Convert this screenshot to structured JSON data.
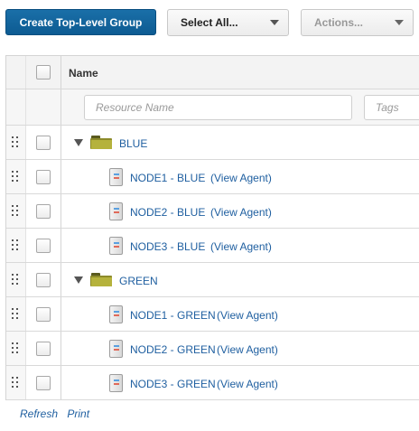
{
  "toolbar": {
    "create_button": "Create Top-Level Group",
    "select_all": "Select All...",
    "actions": "Actions..."
  },
  "table": {
    "header": {
      "name": "Name"
    },
    "filters": {
      "name_placeholder": "Resource Name",
      "tags_placeholder": "Tags"
    },
    "groups": [
      {
        "label": "BLUE",
        "nodes": [
          {
            "label": "NODE1 - BLUE",
            "link": "(View Agent)"
          },
          {
            "label": "NODE2 - BLUE",
            "link": "(View Agent)"
          },
          {
            "label": "NODE3 - BLUE",
            "link": "(View Agent)"
          }
        ]
      },
      {
        "label": "GREEN",
        "nodes": [
          {
            "label": "NODE1 - GREEN",
            "link": "(View Agent)"
          },
          {
            "label": "NODE2 - GREEN",
            "link": "(View Agent)"
          },
          {
            "label": "NODE3 - GREEN",
            "link": "(View Agent)"
          }
        ]
      }
    ]
  },
  "footer": {
    "refresh": "Refresh",
    "print": "Print"
  },
  "colors": {
    "primary": "#0d5b92",
    "link": "#1f5fa0",
    "folder": "#b5b23c"
  }
}
